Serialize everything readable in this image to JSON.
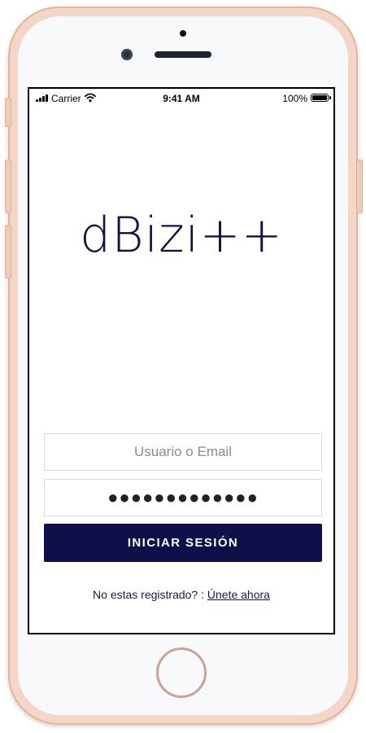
{
  "status_bar": {
    "carrier": "Carrier",
    "time": "9:41 AM",
    "battery": "100%"
  },
  "app": {
    "logo_text": "dBizi++"
  },
  "login_form": {
    "username_placeholder": "Usuario o Email",
    "password_value": "●●●●●●●●●●●●●",
    "submit_label": "INICIAR SESIÓN"
  },
  "register": {
    "prompt": "No estas registrado? : ",
    "link_label": "Únete ahora"
  },
  "colors": {
    "brand": "#0f0f4a",
    "phone_frame": "#f3d6c8"
  },
  "icons": [
    "signal-icon",
    "wifi-icon",
    "battery-icon"
  ]
}
